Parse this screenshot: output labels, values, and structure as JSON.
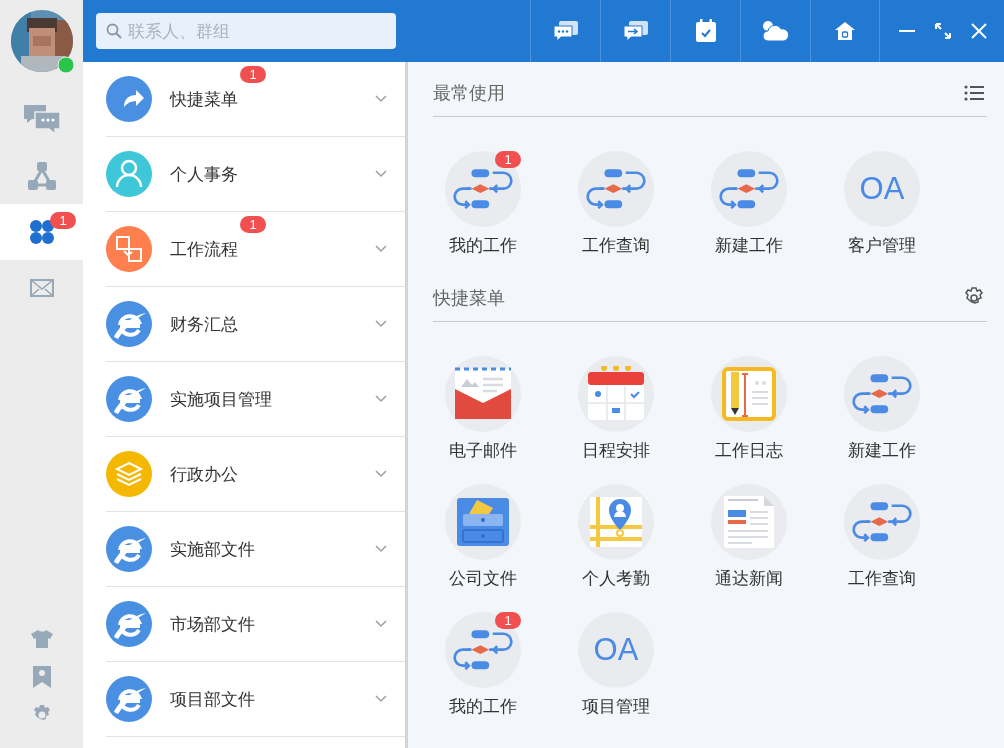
{
  "search": {
    "placeholder": "联系人、群组"
  },
  "toolbar": [
    {
      "kind": "chat"
    },
    {
      "kind": "forward"
    },
    {
      "kind": "calendar"
    },
    {
      "kind": "cloud"
    },
    {
      "kind": "home"
    }
  ],
  "window_controls": [
    {
      "kind": "minimize"
    },
    {
      "kind": "restore"
    },
    {
      "kind": "close"
    }
  ],
  "rail": {
    "items": [
      {
        "kind": "chat",
        "selected": false
      },
      {
        "kind": "org",
        "selected": false
      },
      {
        "kind": "apps",
        "selected": true,
        "badge": "1"
      },
      {
        "kind": "mail",
        "selected": false
      }
    ],
    "tools": [
      {
        "kind": "shirt"
      },
      {
        "kind": "bookmark"
      },
      {
        "kind": "settings"
      }
    ]
  },
  "menu": [
    {
      "label": "快捷菜单",
      "kind": "share",
      "badge": "1"
    },
    {
      "label": "个人事务",
      "kind": "person"
    },
    {
      "label": "工作流程",
      "kind": "flow",
      "badge": "1"
    },
    {
      "label": "财务汇总",
      "kind": "ie"
    },
    {
      "label": "实施项目管理",
      "kind": "ie"
    },
    {
      "label": "行政办公",
      "kind": "layers"
    },
    {
      "label": "实施部文件",
      "kind": "ie"
    },
    {
      "label": "市场部文件",
      "kind": "ie"
    },
    {
      "label": "项目部文件",
      "kind": "ie"
    }
  ],
  "sections": [
    {
      "title": "最常使用",
      "tool": {
        "kind": "list"
      },
      "apps": [
        {
          "label": "我的工作",
          "kind": "flow",
          "badge": "1"
        },
        {
          "label": "工作查询",
          "kind": "flow"
        },
        {
          "label": "新建工作",
          "kind": "flow"
        },
        {
          "label": "客户管理",
          "kind": "text",
          "logo": "OA"
        }
      ]
    },
    {
      "title": "快捷菜单",
      "tool": {
        "kind": "settings"
      },
      "apps": [
        {
          "label": "电子邮件",
          "kind": "mail"
        },
        {
          "label": "日程安排",
          "kind": "calendar"
        },
        {
          "label": "工作日志",
          "kind": "log"
        },
        {
          "label": "新建工作",
          "kind": "flow"
        },
        {
          "label": "公司文件",
          "kind": "folder"
        },
        {
          "label": "个人考勤",
          "kind": "attendance"
        },
        {
          "label": "通达新闻",
          "kind": "news"
        },
        {
          "label": "工作查询",
          "kind": "flow"
        },
        {
          "label": "我的工作",
          "kind": "flow",
          "badge": "1"
        },
        {
          "label": "项目管理",
          "kind": "text",
          "logo": "OA"
        }
      ]
    }
  ]
}
